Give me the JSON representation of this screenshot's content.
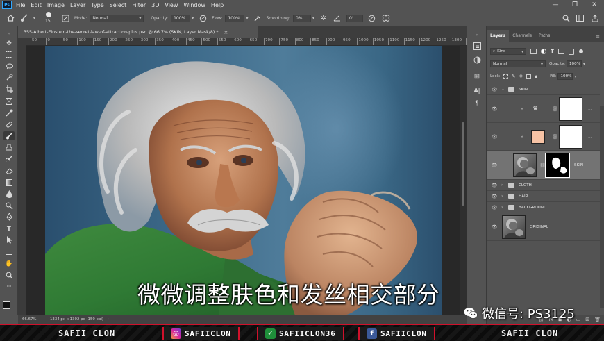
{
  "menubar": {
    "logo": "Ps",
    "items": [
      "File",
      "Edit",
      "Image",
      "Layer",
      "Type",
      "Select",
      "Filter",
      "3D",
      "View",
      "Window",
      "Help"
    ],
    "controls": [
      "—",
      "❐",
      "✕"
    ]
  },
  "options": {
    "brush_size": "15",
    "mode_label": "Mode:",
    "mode_value": "Normal",
    "opacity_label": "Opacity:",
    "opacity_value": "100%",
    "flow_label": "Flow:",
    "flow_value": "100%",
    "smoothing_label": "Smoothing:",
    "smoothing_value": "0%",
    "angle_value": "0°"
  },
  "document": {
    "tab_title": "355-Albert-Einstein-the-secret-law-of-attraction-plus.psd @ 66.7% (SKIN, Layer Mask/8) *",
    "close": "×",
    "ruler_ticks": [
      "50",
      "0",
      "50",
      "100",
      "150",
      "200",
      "250",
      "300",
      "350",
      "400",
      "450",
      "500",
      "550",
      "600",
      "650",
      "700",
      "750",
      "800",
      "850",
      "900",
      "950",
      "1000",
      "1050",
      "1100",
      "1150",
      "1200",
      "1250",
      "1300",
      "1350"
    ]
  },
  "status": {
    "zoom": "66.67%",
    "doc_info": "1334 px x 1302 px (150 ppi)"
  },
  "layers_panel": {
    "tabs": [
      "Layers",
      "Channels",
      "Paths"
    ],
    "filter_kind": "Kind",
    "blend_mode": "Normal",
    "opacity_label": "Opacity:",
    "opacity_value": "100%",
    "lock_label": "Lock:",
    "fill_label": "Fill:",
    "fill_value": "100%",
    "layers": {
      "skin_group": "SKIN",
      "skin_layer": "SKIN",
      "cloth_group": "CLOTH",
      "hair_group": "HAIR",
      "background_group": "BACKGROUND",
      "original_layer": "ORIGINAL"
    },
    "skin_color": "#f7c3a5"
  },
  "overlay": {
    "subtitle": "微微调整肤色和发丝相交部分",
    "wechat": "微信号: PS3125"
  },
  "banner": {
    "left_name": "SAFII CLON",
    "instagram": "SAFIICLON",
    "snapchat": "SAFIICLON36",
    "facebook": "SAFIICLON",
    "right_name": "SAFII CLON"
  },
  "colors": {
    "accent_red": "#d0112b",
    "ps_blue": "#31a8ff"
  }
}
